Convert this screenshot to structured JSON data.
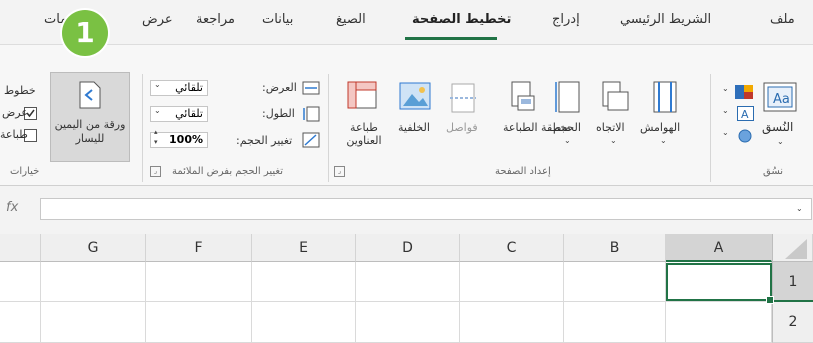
{
  "tabs": [
    "ملف",
    "الشريط الرئيسي",
    "إدراج",
    "تخطيط الصفحة",
    "الصيغ",
    "بيانات",
    "مراجعة",
    "عرض",
    "تعليمات"
  ],
  "active_tab": "تخطيط الصفحة",
  "badge": "1",
  "themes": {
    "label": "النُسق",
    "group": "نسُق"
  },
  "page_setup": {
    "margins": "الهوامش",
    "orientation": "الاتجاه",
    "size": "الحجم",
    "print_area": "منطقة الطباعة",
    "breaks": "فواصل",
    "background": "الخلفية",
    "print_titles": "طباعة العناوين",
    "group": "إعداد الصفحة"
  },
  "scale_to_fit": {
    "width_label": "العرض:",
    "width_value": "تلقائي",
    "height_label": "الطول:",
    "height_value": "تلقائي",
    "scale_label": "تغيير الحجم:",
    "scale_value": "100%",
    "group": "تغيير الحجم بفرض الملائمة"
  },
  "sheet_options": {
    "rtl_button": "ورقة من اليمين لليسار",
    "gridlines": "خطوط",
    "view": "عرض",
    "print": "طباعة",
    "group": "خيارات"
  },
  "formula_bar": {
    "fx": "fx",
    "value": ""
  },
  "columns": [
    "A",
    "B",
    "C",
    "D",
    "E",
    "F",
    "G"
  ],
  "rows": [
    "1",
    "2"
  ],
  "colors": {
    "accent": "#217346",
    "badge": "#7ac143"
  }
}
